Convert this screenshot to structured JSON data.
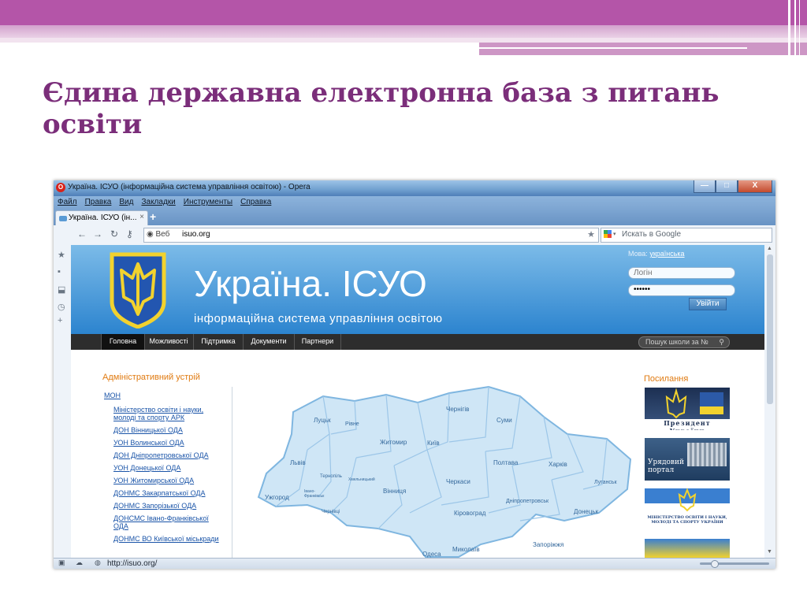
{
  "slide": {
    "title": "Єдина державна електронна база з питань освіти"
  },
  "window": {
    "title": "Україна. ІСУО (інформаційна система управління освітою) - Opera",
    "buttons": {
      "minimize": "—",
      "maximize": "□",
      "close": "X"
    }
  },
  "menu": [
    "Файл",
    "Правка",
    "Вид",
    "Закладки",
    "Инструменты",
    "Справка"
  ],
  "tab": {
    "title": "Україна. ІСУО (ін...",
    "close": "×",
    "add": "+"
  },
  "address": {
    "web_badge": "Веб",
    "url": "isuo.org",
    "search_placeholder": "Искать в Google"
  },
  "status": {
    "url": "http://isuo.org/"
  },
  "site": {
    "title": "Україна. ІСУО",
    "subtitle": "інформаційна система управління освітою",
    "lang_label": "Мова:",
    "lang_value": "українська",
    "login_placeholder": "Логін",
    "password_value": "••••••",
    "login_button": "Увійти",
    "nav": [
      "Головна",
      "Можливості",
      "Підтримка",
      "Документи",
      "Партнери"
    ],
    "school_search": "Пошук школи за №",
    "admin_heading": "Адміністративний устрій",
    "admin_links": [
      "МОН",
      "Міністерство освіти і науки, молоді та спорту АРК",
      "ДОН Вінницької ОДА",
      "УОН Волинської ОДА",
      "ДОН Дніпропетровської ОДА",
      "УОН Донецької ОДА",
      "УОН Житомирської ОДА",
      "ДОНМС Закарпатської ОДА",
      "ДОНМС Запорізької ОДА",
      "ДОНСМС Івано-Франківської ОДА",
      "ДОНМС ВО Київської міськради"
    ],
    "links_heading": "Посилання",
    "banners": {
      "president": "Президент України",
      "government": "Урядовий портал",
      "ministry": "МІНІСТЕРСТВО ОСВІТИ І НАУКИ, МОЛОДІ ТА СПОРТУ УКРАЇНИ"
    },
    "regions": [
      "Луцьк",
      "Рівне",
      "Житомир",
      "Київ",
      "Чернігів",
      "Суми",
      "Львів",
      "Тернопіль",
      "Хмельницький",
      "Вінниця",
      "Івано-Франківськ",
      "Ужгород",
      "Чернівці",
      "Черкаси",
      "Полтава",
      "Харків",
      "Луганськ",
      "Дніпропетровськ",
      "Донецьк",
      "Кіровоград",
      "Миколаїв",
      "Одеса",
      "Запоріжжя"
    ]
  },
  "colors": {
    "slide_title": "#7b2e7a",
    "slide_band": "#b455a8",
    "site_header": "#2c84cf",
    "nav_bar": "#2d2d2d",
    "accent_heading": "#e07a10",
    "link": "#1a54a8",
    "map_fill": "#cfe6f6",
    "map_stroke": "#7fb6e0"
  }
}
